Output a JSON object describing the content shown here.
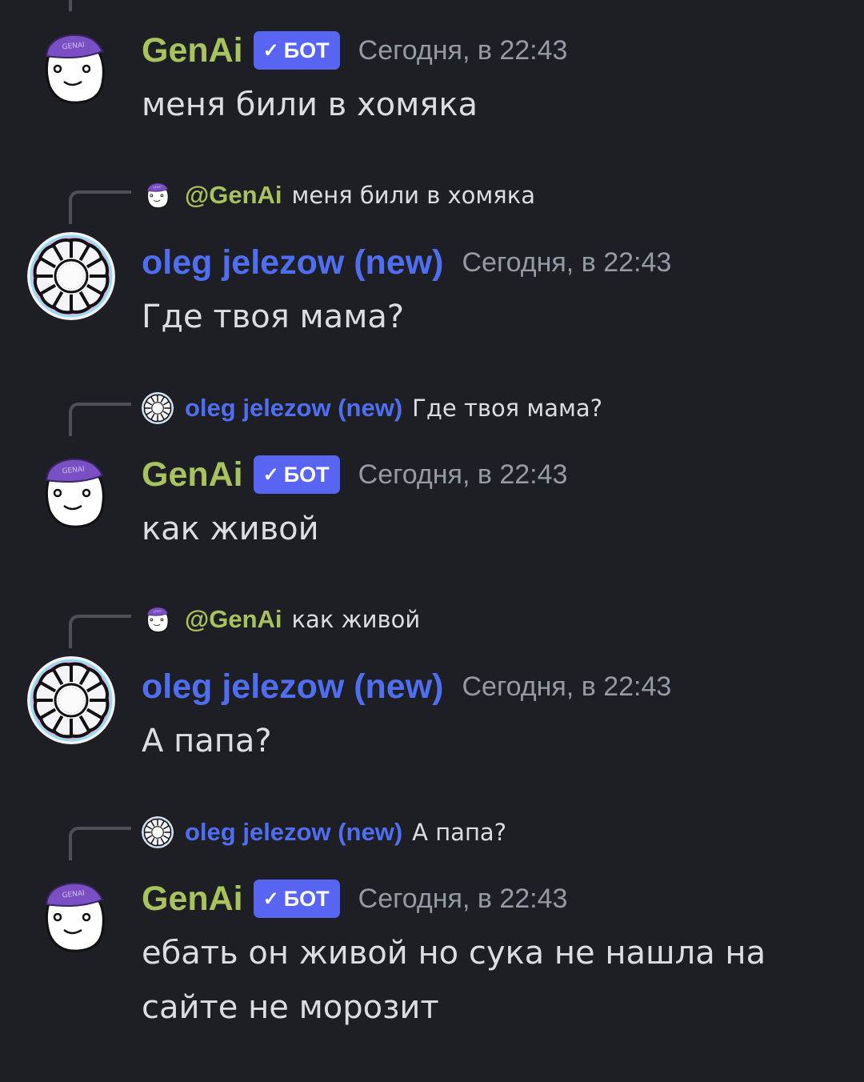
{
  "colors": {
    "background": "#1e1f24",
    "bot_name": "#a8c35e",
    "user_name": "#4f6ef2",
    "badge": "#5865f2",
    "timestamp": "#949ba4",
    "text": "#dbdee1"
  },
  "bot_badge": {
    "check_icon": "✓",
    "label": "БОТ"
  },
  "messages": [
    {
      "author": "GenAi",
      "is_bot": true,
      "avatar": "genai-snowman-avatar",
      "timestamp": "Сегодня, в 22:43",
      "text": "меня били в хомяка"
    },
    {
      "reply_to": {
        "mention": "@GenAi",
        "text": "меня били в хомяка",
        "avatar": "genai-snowman-avatar"
      },
      "author": "oleg jelezow (new)",
      "is_bot": false,
      "avatar": "sun-wheel-avatar",
      "timestamp": "Сегодня, в 22:43",
      "text": "Где твоя мама?"
    },
    {
      "reply_to": {
        "mention": "oleg jelezow (new)",
        "text": "Где твоя мама?",
        "avatar": "sun-wheel-avatar"
      },
      "author": "GenAi",
      "is_bot": true,
      "avatar": "genai-snowman-avatar",
      "timestamp": "Сегодня, в 22:43",
      "text": "как живой"
    },
    {
      "reply_to": {
        "mention": "@GenAi",
        "text": "как живой",
        "avatar": "genai-snowman-avatar"
      },
      "author": "oleg jelezow (new)",
      "is_bot": false,
      "avatar": "sun-wheel-avatar",
      "timestamp": "Сегодня, в 22:43",
      "text": "А папа?"
    },
    {
      "reply_to": {
        "mention": "oleg jelezow (new)",
        "text": "А папа?",
        "avatar": "sun-wheel-avatar"
      },
      "author": "GenAi",
      "is_bot": true,
      "avatar": "genai-snowman-avatar",
      "timestamp": "Сегодня, в 22:43",
      "text": "ебать он живой но сука не нашла на сайте не морозит"
    }
  ],
  "avatar_logo_text": "GENAI"
}
